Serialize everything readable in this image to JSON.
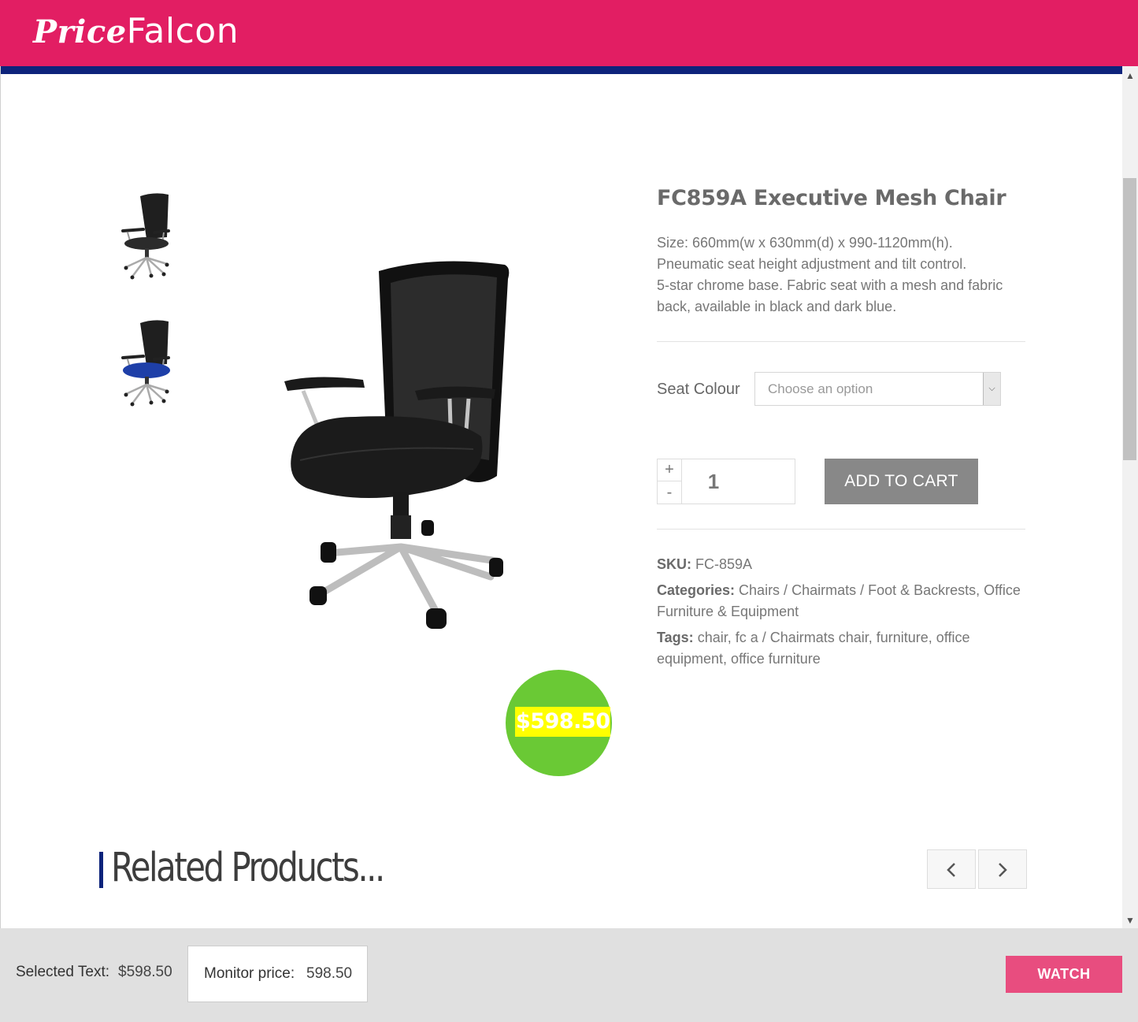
{
  "header": {
    "brand_italic": "Price",
    "brand_plain": "Falcon"
  },
  "product": {
    "title": "FC859A Executive Mesh Chair",
    "description": [
      "Size: 660mm(w x 630mm(d) x 990-1120mm(h).",
      "Pneumatic seat height adjustment and tilt control.",
      "5-star chrome base.  Fabric seat with a mesh and fabric back, available in black and dark blue."
    ],
    "price_badge": "$598.50",
    "seat_colour": {
      "label": "Seat Colour",
      "placeholder": "Choose an option"
    },
    "quantity": {
      "plus": "+",
      "minus": "-",
      "value": "1"
    },
    "add_to_cart": "ADD TO CART",
    "meta": {
      "sku_label": "SKU:",
      "sku": "FC-859A",
      "categories_label": "Categories:",
      "categories": "Chairs / Chairmats / Foot & Backrests, Office Furniture & Equipment",
      "tags_label": "Tags:",
      "tags": "chair, fc a / Chairmats chair, furniture, office equipment, office furniture"
    },
    "thumbnails": [
      {
        "name": "black-chair-thumbnail",
        "seat_color": "#2b2b2b"
      },
      {
        "name": "blue-chair-thumbnail",
        "seat_color": "#1e3fa8"
      }
    ]
  },
  "related": {
    "title": "Related Products..."
  },
  "bottom_bar": {
    "selected_label": "Selected Text:",
    "selected_value": "$598.50",
    "monitor_label": "Monitor price:",
    "monitor_value": "598.50",
    "watch": "WATCH"
  },
  "colors": {
    "brand": "#e21e63",
    "navy": "#0d237b",
    "price_bubble": "#6ac935",
    "watch_button": "#e84d7f"
  }
}
